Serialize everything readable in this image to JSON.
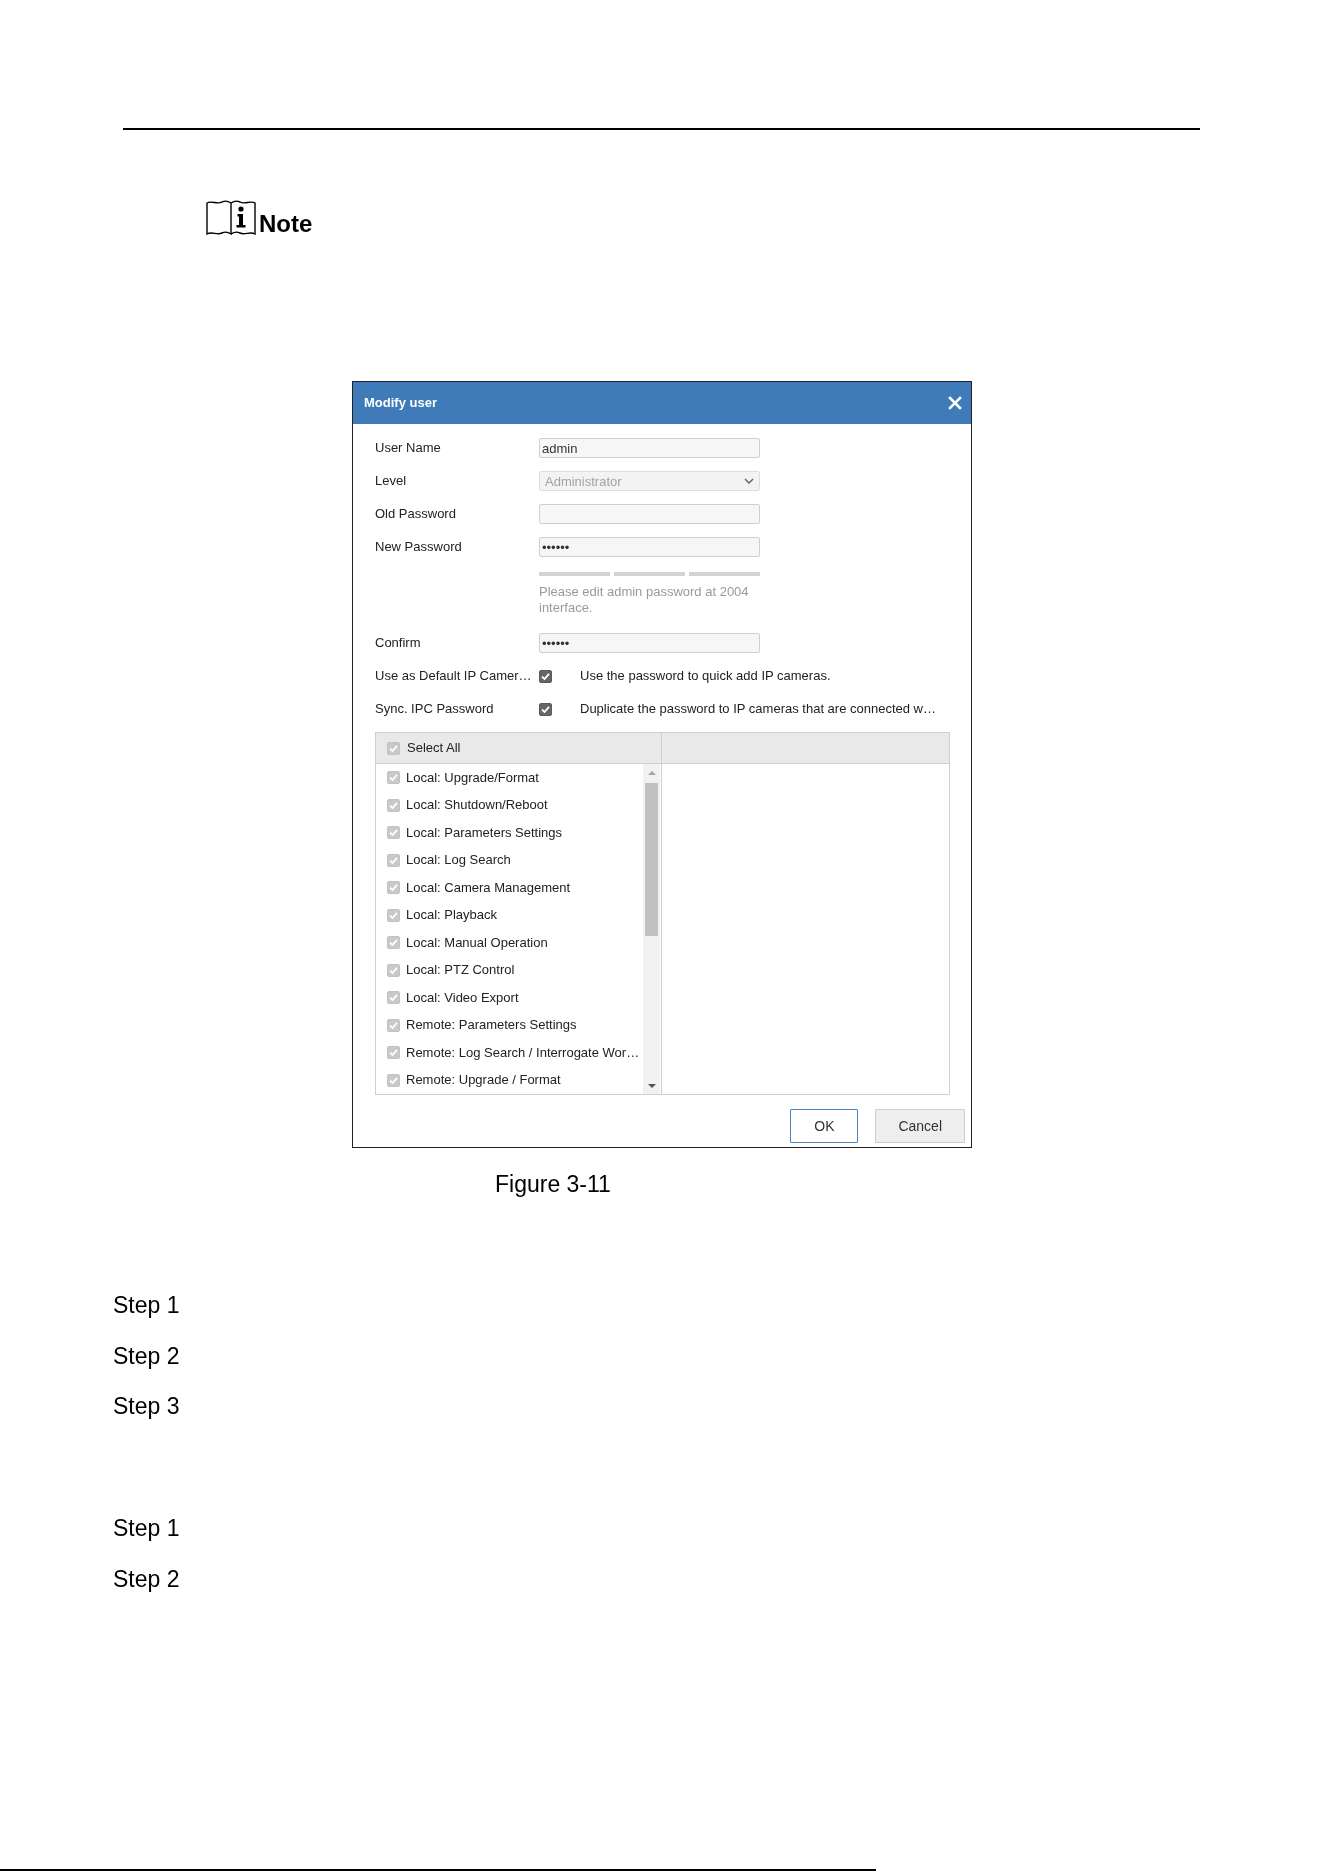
{
  "note": {
    "label": "Note"
  },
  "dialog": {
    "title": "Modify user",
    "fields": [
      {
        "kind": "text",
        "label": "User Name",
        "value": "admin",
        "disabled": false
      },
      {
        "kind": "select",
        "label": "Level",
        "value": "Administrator",
        "disabled": true
      },
      {
        "kind": "password",
        "label": "Old Password",
        "disabled": false
      },
      {
        "kind": "password",
        "label": "New Password",
        "value": "••••••",
        "disabled": false,
        "strength_segments": [
          {
            "on": false
          },
          {
            "on": false
          },
          {
            "on": false
          }
        ],
        "hint": "Please edit admin password at 2004 interface."
      },
      {
        "kind": "password",
        "label": "Confirm",
        "value": "••••••",
        "disabled": false
      },
      {
        "kind": "checkbox",
        "label": "Use as Default IP Camer…",
        "checked": true,
        "description": "Use the password to quick add IP cameras."
      },
      {
        "kind": "checkbox",
        "label": "Sync. IPC Password",
        "checked": true,
        "description": "Duplicate the password to IP cameras that are connected w…"
      }
    ],
    "permissions": {
      "select_all": {
        "label": "Select All",
        "checked": true,
        "disabled": true
      },
      "items": [
        {
          "label": "Local: Upgrade/Format",
          "checked": true,
          "disabled": true
        },
        {
          "label": "Local: Shutdown/Reboot",
          "checked": true,
          "disabled": true
        },
        {
          "label": "Local: Parameters Settings",
          "checked": true,
          "disabled": true
        },
        {
          "label": "Local: Log Search",
          "checked": true,
          "disabled": true
        },
        {
          "label": "Local: Camera Management",
          "checked": true,
          "disabled": true
        },
        {
          "label": "Local: Playback",
          "checked": true,
          "disabled": true
        },
        {
          "label": "Local: Manual Operation",
          "checked": true,
          "disabled": true
        },
        {
          "label": "Local: PTZ Control",
          "checked": true,
          "disabled": true
        },
        {
          "label": "Local: Video Export",
          "checked": true,
          "disabled": true
        },
        {
          "label": "Remote: Parameters Settings",
          "checked": true,
          "disabled": true
        },
        {
          "label": "Remote: Log Search / Interrogate Wor…",
          "checked": true,
          "disabled": true
        },
        {
          "label": "Remote: Upgrade / Format",
          "checked": true,
          "disabled": true
        }
      ]
    },
    "buttons": [
      {
        "kind": "primary",
        "label": "OK"
      },
      {
        "kind": "default",
        "label": "Cancel"
      }
    ]
  },
  "caption": "Figure 3-11",
  "step_groups": [
    [
      "Step 1",
      "Step 2",
      "Step 3"
    ],
    [
      "Step 1",
      "Step 2"
    ]
  ]
}
